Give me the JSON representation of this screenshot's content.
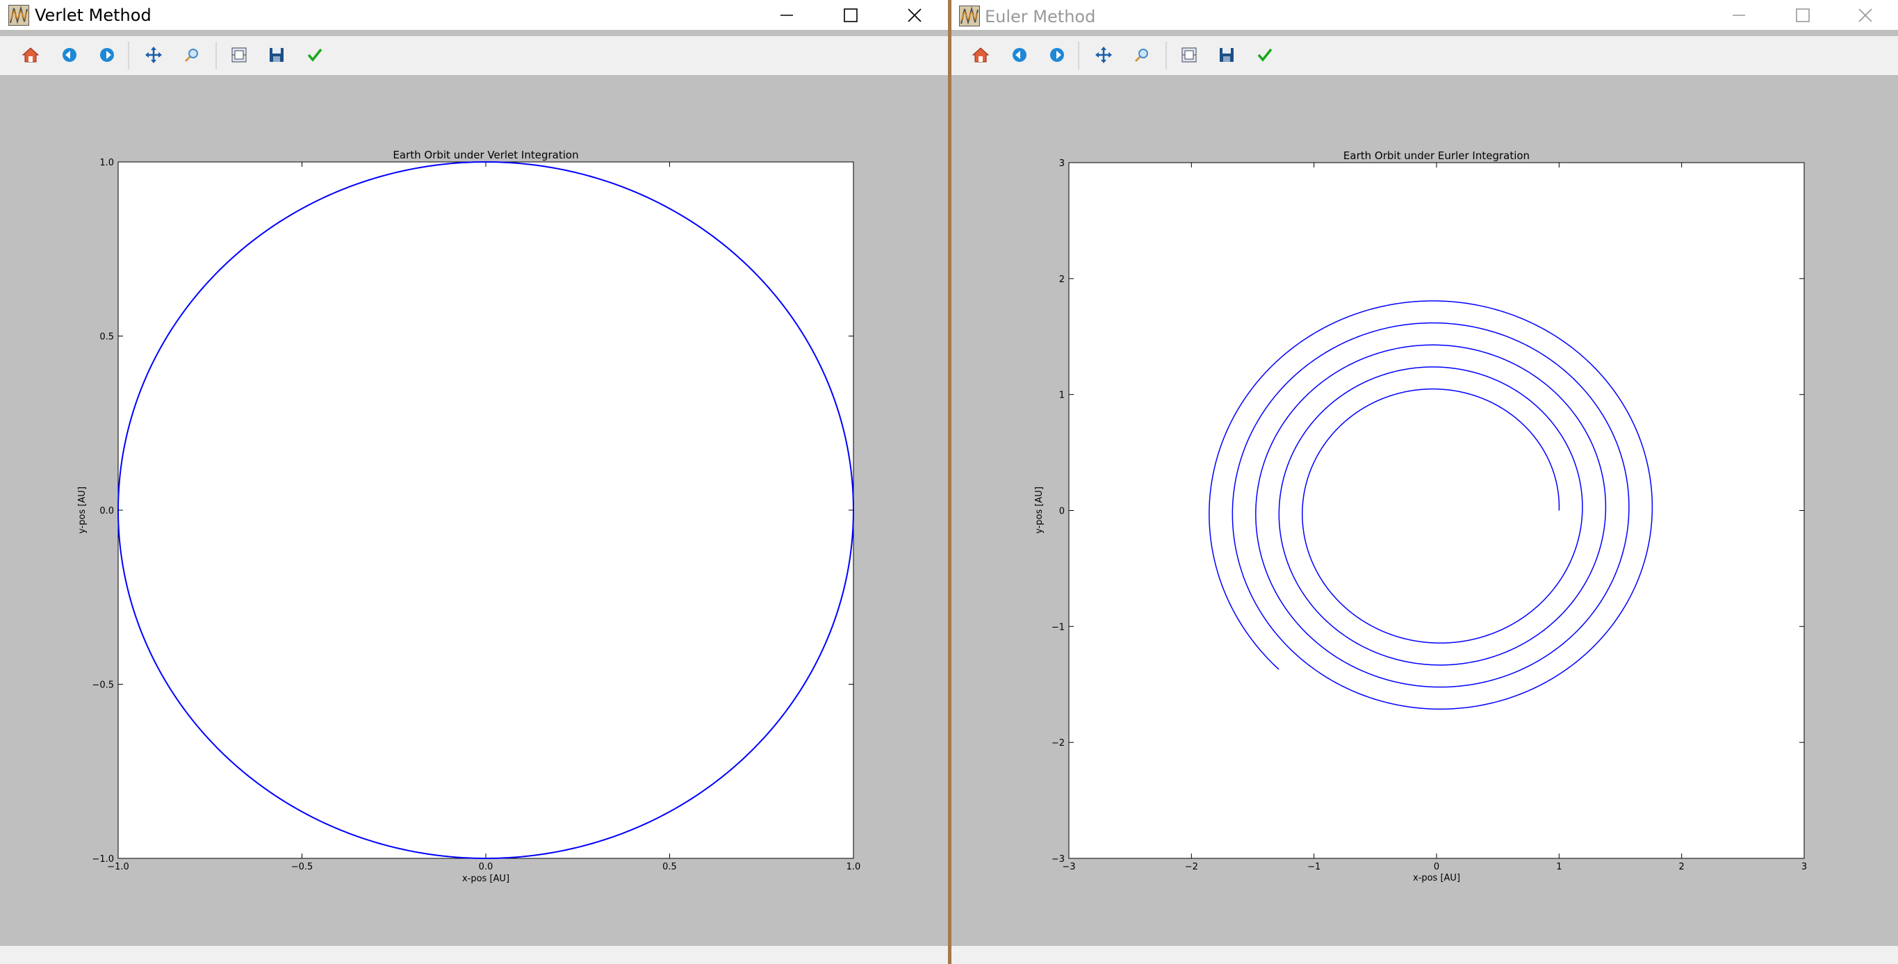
{
  "windows": [
    {
      "title": "Verlet Method",
      "active": true,
      "toolbar": [
        "home-icon",
        "back-icon",
        "forward-icon",
        "pan-icon",
        "zoom-icon",
        "subplots-icon",
        "save-icon",
        "edit-icon"
      ],
      "chart_data": {
        "type": "line",
        "title": "Earth Orbit under Verlet Integration",
        "xlabel": "x-pos [AU]",
        "ylabel": "y-pos [AU]",
        "xlim": [
          -1.0,
          1.0
        ],
        "ylim": [
          -1.0,
          1.0
        ],
        "xticks": [
          -1.0,
          -0.5,
          0.0,
          0.5,
          1.0
        ],
        "xticklabels": [
          "−1.0",
          "−0.5",
          "0.0",
          "0.5",
          "1.0"
        ],
        "yticks": [
          -1.0,
          -0.5,
          0.0,
          0.5,
          1.0
        ],
        "yticklabels": [
          "−1.0",
          "−0.5",
          "0.0",
          "0.5",
          "1.0"
        ],
        "grid": false,
        "line_color": "#0000ff",
        "series": [
          {
            "kind": "circle",
            "center": [
              0,
              0
            ],
            "radius": 1.0
          }
        ]
      }
    },
    {
      "title": "Euler Method",
      "active": false,
      "toolbar": [
        "home-icon",
        "back-icon",
        "forward-icon",
        "pan-icon",
        "zoom-icon",
        "subplots-icon",
        "save-icon",
        "edit-icon"
      ],
      "chart_data": {
        "type": "line",
        "title": "Earth Orbit under Eurler Integration",
        "xlabel": "x-pos [AU]",
        "ylabel": "y-pos [AU]",
        "xlim": [
          -3,
          3
        ],
        "ylim": [
          -3,
          3
        ],
        "xticks": [
          -3,
          -2,
          -1,
          0,
          1,
          2,
          3
        ],
        "xticklabels": [
          "−3",
          "−2",
          "−1",
          "0",
          "1",
          "2",
          "3"
        ],
        "yticks": [
          -3,
          -2,
          -1,
          0,
          1,
          2,
          3
        ],
        "yticklabels": [
          "−3",
          "−2",
          "−1",
          "0",
          "1",
          "2",
          "3"
        ],
        "grid": false,
        "line_color": "#0000ff",
        "series": [
          {
            "kind": "spiral",
            "start_radius": 1.0,
            "growth_per_turn": 0.19,
            "turns": 4.63,
            "direction": "counterclockwise"
          }
        ]
      }
    }
  ]
}
